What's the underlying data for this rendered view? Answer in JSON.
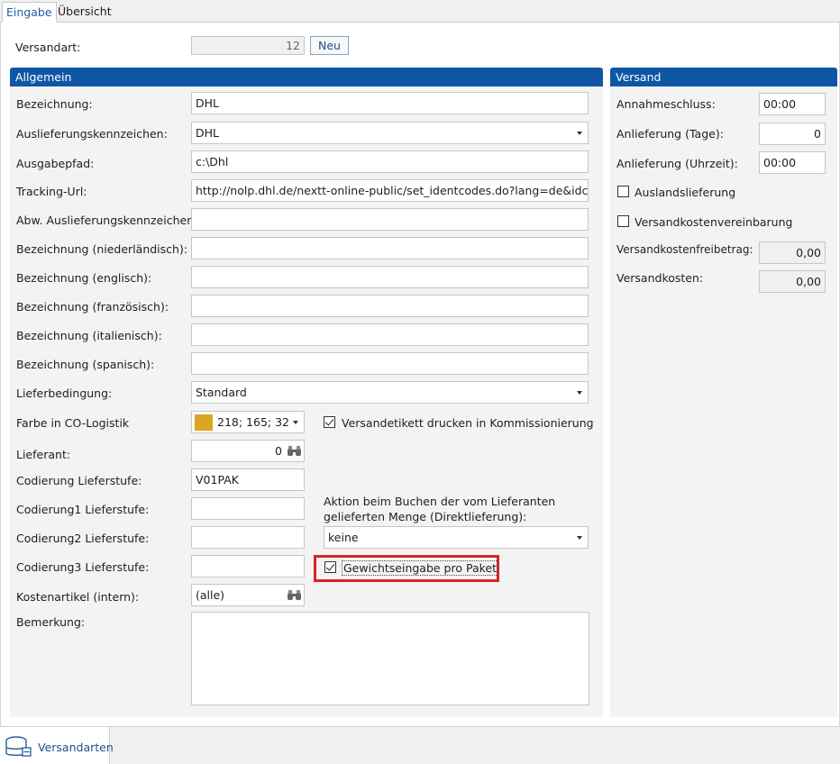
{
  "tabs": {
    "eingabe": "Eingabe",
    "uebersicht": "Übersicht"
  },
  "header": {
    "versandart_label": "Versandart:",
    "versandart_value": "12",
    "neu_button": "Neu"
  },
  "allgemein": {
    "title": "Allgemein",
    "bezeichnung_label": "Bezeichnung:",
    "bezeichnung_value": "DHL",
    "auslieferungskennzeichen_label": "Auslieferungskennzeichen:",
    "auslieferungskennzeichen_value": "DHL",
    "ausgabepfad_label": "Ausgabepfad:",
    "ausgabepfad_value": "c:\\Dhl",
    "tracking_url_label": "Tracking-Url:",
    "tracking_url_value": "http://nolp.dhl.de/nextt-online-public/set_identcodes.do?lang=de&idc=#tr",
    "abw_auslieferungskennzeichen_label": "Abw. Auslieferungskennzeichen:",
    "bezeichnung_nl_label": "Bezeichnung (niederländisch):",
    "bezeichnung_en_label": "Bezeichnung (englisch):",
    "bezeichnung_fr_label": "Bezeichnung (französisch):",
    "bezeichnung_it_label": "Bezeichnung (italienisch):",
    "bezeichnung_es_label": "Bezeichnung (spanisch):",
    "lieferbedingung_label": "Lieferbedingung:",
    "lieferbedingung_value": "Standard",
    "farbe_label": "Farbe in CO-Logistik",
    "farbe_value": "218; 165; 32",
    "farbe_color": "#daa520",
    "versandetikett_label": "Versandetikett drucken in Kommissionierung",
    "lieferant_label": "Lieferant:",
    "lieferant_value": "0",
    "codierung_label": "Codierung Lieferstufe:",
    "codierung_value": "V01PAK",
    "codierung1_label": "Codierung1 Lieferstufe:",
    "codierung2_label": "Codierung2 Lieferstufe:",
    "codierung3_label": "Codierung3 Lieferstufe:",
    "aktion_label_1": "Aktion beim Buchen der vom Lieferanten",
    "aktion_label_2": "gelieferten Menge (Direktlieferung):",
    "aktion_value": "keine",
    "gewicht_label": "Gewichtseingabe pro Paket",
    "kostenartikel_label": "Kostenartikel (intern):",
    "kostenartikel_value": "(alle)",
    "bemerkung_label": "Bemerkung:"
  },
  "versand": {
    "title": "Versand",
    "annahmeschluss_label": "Annahmeschluss:",
    "annahmeschluss_value": "00:00",
    "anlieferung_tage_label": "Anlieferung (Tage):",
    "anlieferung_tage_value": "0",
    "anlieferung_uhrzeit_label": "Anlieferung (Uhrzeit):",
    "anlieferung_uhrzeit_value": "00:00",
    "auslandslieferung_label": "Auslandslieferung",
    "vereinbarung_label": "Versandkostenvereinbarung",
    "freibetrag_label": "Versandkostenfreibetrag:",
    "freibetrag_value": "0,00",
    "versandkosten_label": "Versandkosten:",
    "versandkosten_value": "0,00"
  },
  "statusbar": {
    "versandarten": "Versandarten"
  }
}
